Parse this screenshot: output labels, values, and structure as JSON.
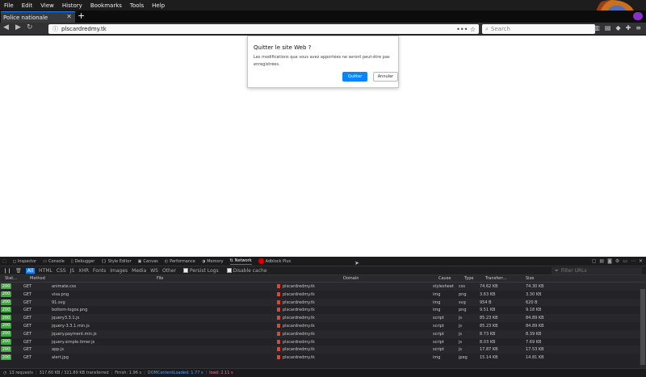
{
  "menubar": {
    "items": [
      "File",
      "Edit",
      "View",
      "History",
      "Bookmarks",
      "Tools",
      "Help"
    ]
  },
  "tab": {
    "title": "Police nationale"
  },
  "urlbar": {
    "url": "plscardredmy.tk",
    "more": "•••",
    "bookmark": "☆"
  },
  "searchbar": {
    "placeholder": "Search"
  },
  "dialog": {
    "title": "Quitter le site Web ?",
    "message": "Les modifications que vous avez apportées ne seront peut-être pas enregistrées.",
    "ok_label": "Quitter",
    "cancel_label": "Annuler"
  },
  "devtools": {
    "tabs": [
      "Inspector",
      "Console",
      "Debugger",
      "Style Editor",
      "Canvas",
      "Performance",
      "Memory",
      "Network",
      "Adblock Plus"
    ],
    "active_tab": "Network",
    "filters": [
      "All",
      "HTML",
      "CSS",
      "JS",
      "XHR",
      "Fonts",
      "Images",
      "Media",
      "WS",
      "Other"
    ],
    "persist_logs": "Persist Logs",
    "disable_cache": "Disable cache",
    "filter_placeholder": "Filter URLs",
    "columns": {
      "status": "Stat...",
      "method": "Method",
      "file": "File",
      "domain": "Domain",
      "cause": "Cause",
      "type": "Type",
      "transferred": "Transferr...",
      "size": "Size"
    },
    "rows": [
      {
        "status": "200",
        "method": "GET",
        "file": "animate.css",
        "domain": "plscardredmy.tk",
        "cause": "stylesheet",
        "type": "css",
        "transferred": "74.62 KB",
        "size": "74.30 KB"
      },
      {
        "status": "200",
        "method": "GET",
        "file": "visa.png",
        "domain": "plscardredmy.tk",
        "cause": "img",
        "type": "png",
        "transferred": "3.63 KB",
        "size": "3.30 KB"
      },
      {
        "status": "200",
        "method": "GET",
        "file": "91.svg",
        "domain": "plscardredmy.tk",
        "cause": "img",
        "type": "svg",
        "transferred": "954 B",
        "size": "620 B"
      },
      {
        "status": "200",
        "method": "GET",
        "file": "bottom-logos.png",
        "domain": "plscardredmy.tk",
        "cause": "img",
        "type": "png",
        "transferred": "9.51 KB",
        "size": "9.18 KB"
      },
      {
        "status": "200",
        "method": "GET",
        "file": "jquery3.3.1.js",
        "domain": "plscardredmy.tk",
        "cause": "script",
        "type": "js",
        "transferred": "85.23 KB",
        "size": "84.89 KB"
      },
      {
        "status": "200",
        "method": "GET",
        "file": "jquery-3.3.1.min.js",
        "domain": "plscardredmy.tk",
        "cause": "script",
        "type": "js",
        "transferred": "85.23 KB",
        "size": "84.89 KB"
      },
      {
        "status": "200",
        "method": "GET",
        "file": "jquery.payment.min.js",
        "domain": "plscardredmy.tk",
        "cause": "script",
        "type": "js",
        "transferred": "8.73 KB",
        "size": "8.39 KB"
      },
      {
        "status": "200",
        "method": "GET",
        "file": "jquery.simple.timer.js",
        "domain": "plscardredmy.tk",
        "cause": "script",
        "type": "js",
        "transferred": "8.03 KB",
        "size": "7.69 KB"
      },
      {
        "status": "200",
        "method": "GET",
        "file": "app.js",
        "domain": "plscardredmy.tk",
        "cause": "script",
        "type": "js",
        "transferred": "17.87 KB",
        "size": "17.53 KB"
      },
      {
        "status": "200",
        "method": "GET",
        "file": "alert.jpg",
        "domain": "plscardredmy.tk",
        "cause": "img",
        "type": "jpeg",
        "transferred": "15.14 KB",
        "size": "14.81 KB"
      }
    ],
    "summary": {
      "requests": "13 requests",
      "transferred": "317.60 KB / 321.89 KB transferred",
      "finish": "Finish: 1.96 s",
      "dom_content_loaded": "DOMContentLoaded: 1.77 s",
      "load": "load: 2.11 s"
    }
  },
  "colors": {
    "accent": "#0a84ff",
    "status_ok": "#3fa83f"
  }
}
